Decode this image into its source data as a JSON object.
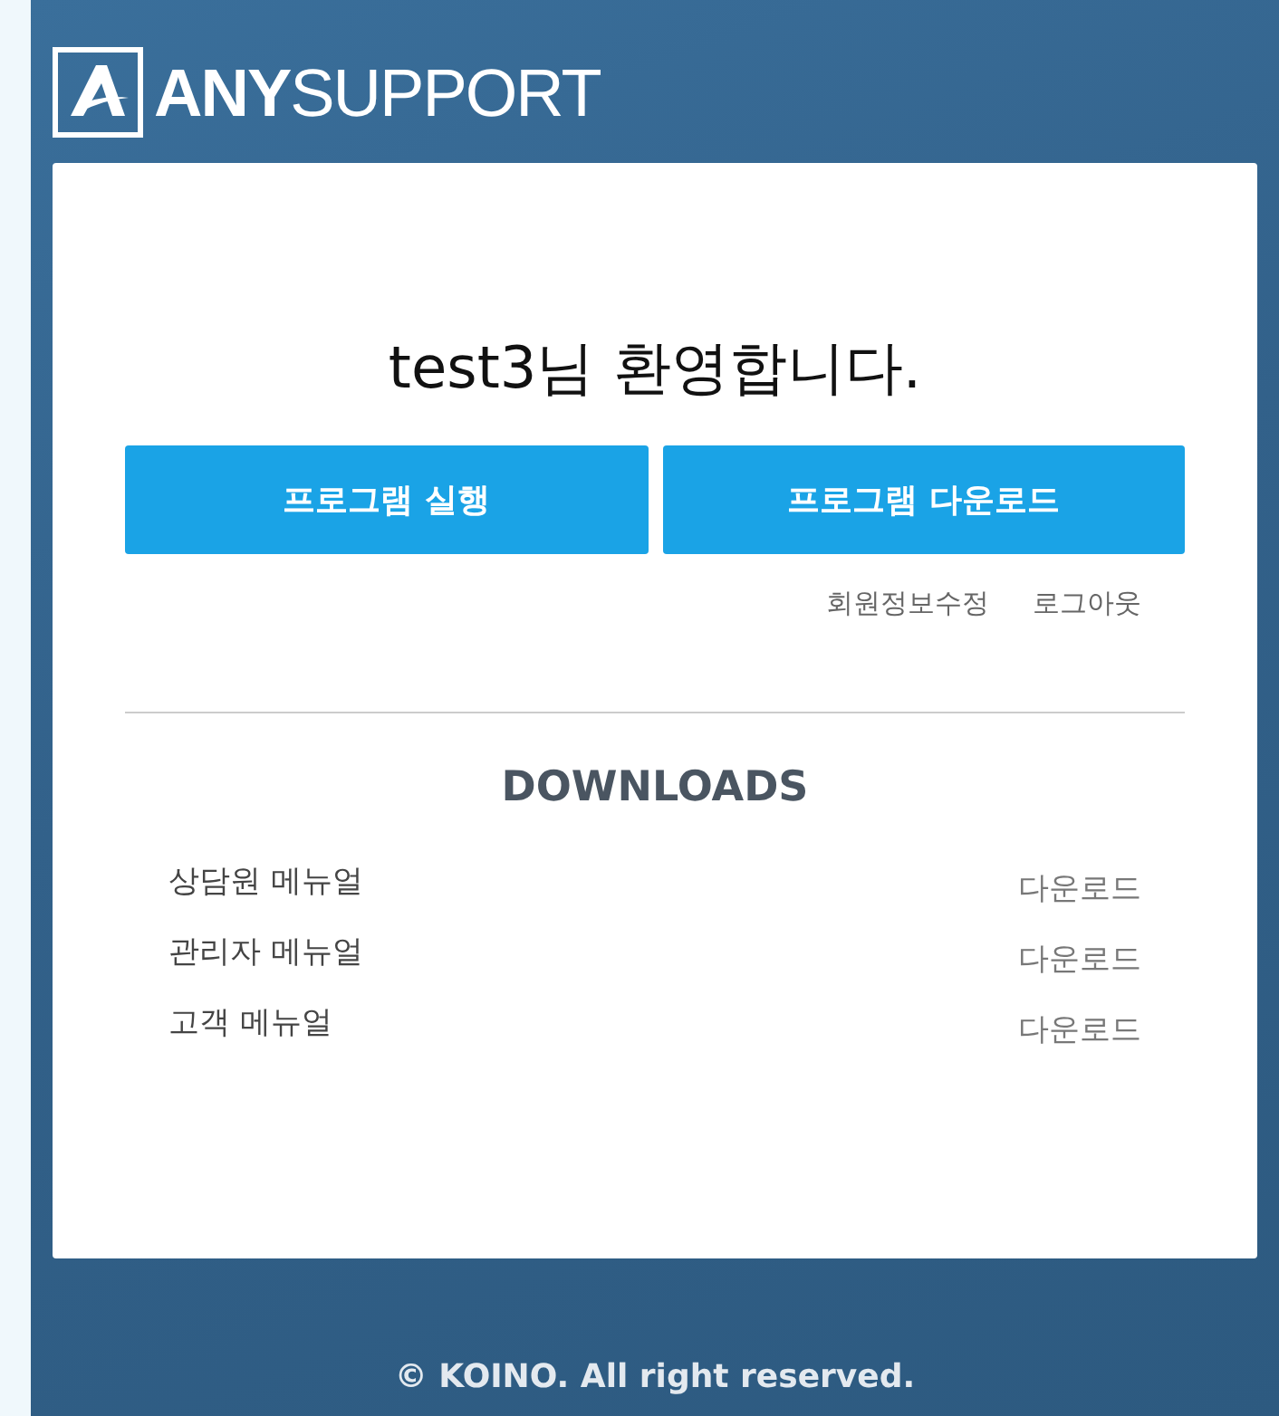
{
  "header": {
    "logo_text": "**ANY**SUPPORT"
  },
  "welcome": "test3님 환영합니다.",
  "buttons": [
    "프로그램 실행",
    "프로그램 다운로드"
  ],
  "account_links": [
    "회원정보수정",
    "로그아웃"
  ],
  "downloads": {
    "title": "DOWNLOADS",
    "items": [
      {
        "name": "상담원 메뉴얼",
        "action": "다운로드"
      },
      {
        "name": "관리자 메뉴얼",
        "action": "다운로드"
      },
      {
        "name": "고객 메뉴얼",
        "action": "다운로드"
      }
    ]
  },
  "footer": "© KOINO. All right reserved."
}
